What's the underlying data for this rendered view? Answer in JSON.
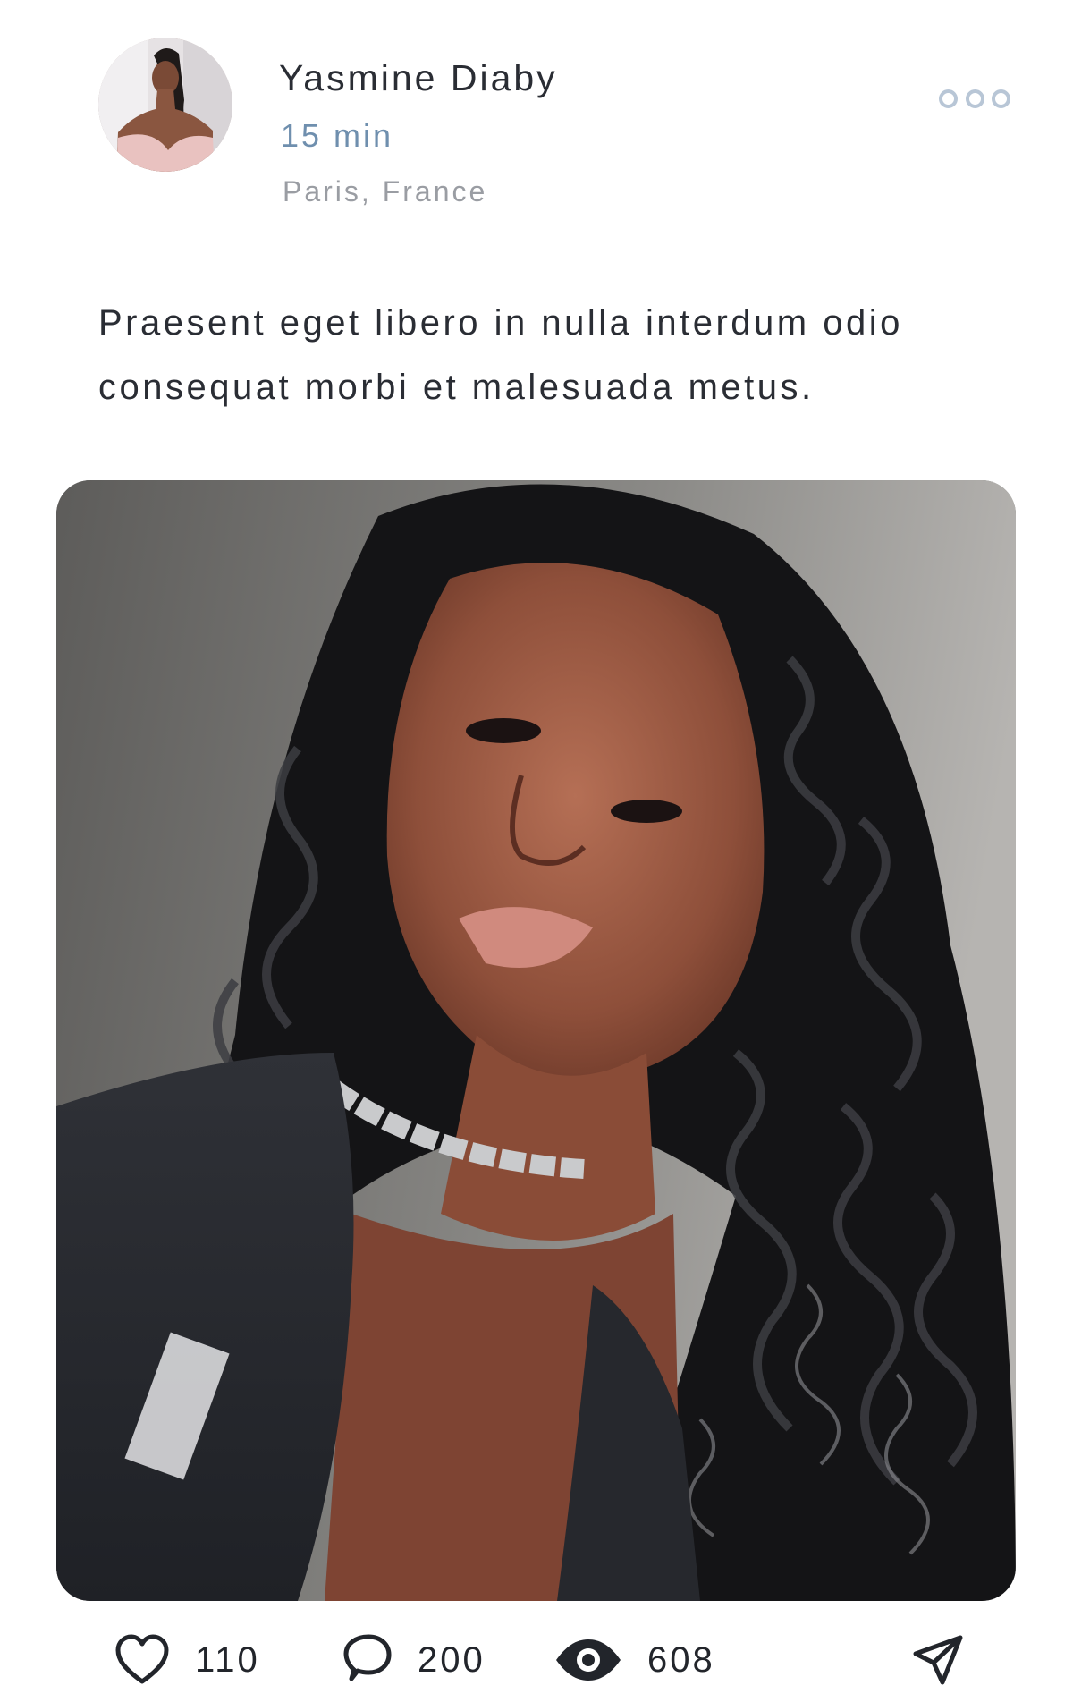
{
  "post": {
    "author": {
      "name": "Yasmine Diaby",
      "time": "15 min",
      "location": "Paris, France",
      "avatar_icon": "avatar-photo"
    },
    "more_icon": "more-dots-icon",
    "caption": "Praesent eget libero in nulla interdum odio consequat morbi et malesuada metus.",
    "photo_icon": "post-photo",
    "stats": {
      "likes": "110",
      "comments": "200",
      "views": "608"
    },
    "icons": {
      "like": "heart-icon",
      "comment": "comment-bubble-icon",
      "view": "eye-icon",
      "share": "send-icon"
    }
  },
  "colors": {
    "name_text": "#2a2d34",
    "time_text": "#6f8fae",
    "location_text": "#9a9da3",
    "more_dots": "#b8c6d6",
    "icon_dark": "#22252b"
  }
}
